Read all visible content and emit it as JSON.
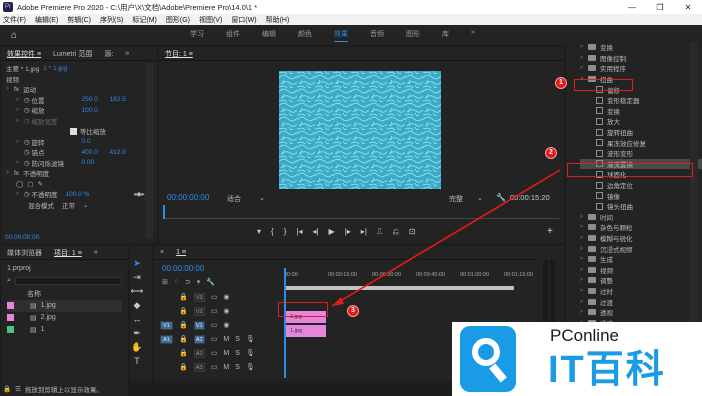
{
  "window": {
    "title": "Adobe Premiere Pro 2020 - C:\\用户\\X\\文档\\Adobe\\Premiere Pro\\14.0\\1 *",
    "controls": [
      "—",
      "❐",
      "✕"
    ]
  },
  "menu": [
    "文件(F)",
    "编辑(E)",
    "剪辑(C)",
    "序列(S)",
    "标记(M)",
    "图形(G)",
    "视图(V)",
    "窗口(W)",
    "帮助(H)"
  ],
  "workspaces": {
    "tabs": [
      "学习",
      "组件",
      "编辑",
      "颜色",
      "效果",
      "音频",
      "图形",
      "库"
    ],
    "active": "效果",
    "more": "»"
  },
  "effect_controls": {
    "tabs": [
      "效果控件 ≡",
      "Lumetri 范围",
      "源:"
    ],
    "more": "»",
    "clip": "主要 * 1.jpg",
    "clip_link": "1 * 1.jpg",
    "section_video": "视频",
    "motion": {
      "label": "运动",
      "position_label": "位置",
      "position_x": "250.0",
      "position_y": "182.5",
      "scale_label": "缩放",
      "scale_value": "100.0",
      "scale_width_label": "缩放宽度",
      "uniform_label": "等比缩放",
      "rotation_label": "旋转",
      "rotation_value": "0.0",
      "anchor_label": "锚点",
      "anchor_x": "400.0",
      "anchor_y": "412.0",
      "antiflicker_label": "防闪烁滤镜",
      "antiflicker_value": "0.00"
    },
    "opacity": {
      "label": "不透明度",
      "value_label": "不透明度",
      "value": "100.0 %",
      "blend_label": "混合模式",
      "blend_value": "正常"
    },
    "timecode": "00:00:00:00"
  },
  "program": {
    "title": "节目: 1 ≡",
    "timecode_left": "00:00:00:00",
    "fit": "适合",
    "quality": "完整",
    "timecode_right": "00:00:15:20",
    "transport": [
      "▾",
      "{",
      "}",
      "|◂",
      "◂|",
      "▶",
      "|▸",
      "▸|",
      "⎍",
      "⎌",
      "⊡"
    ],
    "add": "+"
  },
  "project": {
    "tabs": [
      "媒体浏览器",
      "项目: 1 ≡"
    ],
    "more": "»",
    "file": "1.prproj",
    "column_name": "名称",
    "items": [
      {
        "name": "1.jpg",
        "color": "#e586dc"
      },
      {
        "name": "2.jpg",
        "color": "#e586dc"
      },
      {
        "name": "1",
        "color": "#4ec280"
      }
    ],
    "status": "拖放到剪辑上以显示效果。"
  },
  "timeline": {
    "title": "1 ≡",
    "close": "×",
    "timecode": "00:00:00:00",
    "ruler": [
      "00:00",
      "00:00:15:00",
      "00:00:30:00",
      "00:00:45:00",
      "00:01:00:00",
      "00:01:15:00"
    ],
    "video_tracks": [
      "V3",
      "V2",
      "V1"
    ],
    "audio_tracks": [
      "A1",
      "A2",
      "A3"
    ],
    "v_source": "V1",
    "a_source": "A1",
    "clip_top": "2.jpg",
    "clip_bottom": "1.jpg"
  },
  "effects_panel": {
    "items": [
      {
        "label": "变换",
        "kind": "folder"
      },
      {
        "label": "图像控制",
        "kind": "folder"
      },
      {
        "label": "实用程序",
        "kind": "folder"
      },
      {
        "label": "扭曲",
        "kind": "folder-open"
      },
      {
        "label": "偏移",
        "kind": "fx"
      },
      {
        "label": "变形稳定器",
        "kind": "fx"
      },
      {
        "label": "变换",
        "kind": "fx"
      },
      {
        "label": "放大",
        "kind": "fx"
      },
      {
        "label": "旋转扭曲",
        "kind": "fx"
      },
      {
        "label": "果冻效应修复",
        "kind": "fx"
      },
      {
        "label": "波形变形",
        "kind": "fx"
      },
      {
        "label": "湍流置换",
        "kind": "fx-selected"
      },
      {
        "label": "球面化",
        "kind": "fx"
      },
      {
        "label": "边角定位",
        "kind": "fx"
      },
      {
        "label": "镜像",
        "kind": "fx"
      },
      {
        "label": "镜头扭曲",
        "kind": "fx"
      },
      {
        "label": "时间",
        "kind": "folder"
      },
      {
        "label": "杂色与颗粒",
        "kind": "folder"
      },
      {
        "label": "模糊与锐化",
        "kind": "folder"
      },
      {
        "label": "沉浸式视频",
        "kind": "folder"
      },
      {
        "label": "生成",
        "kind": "folder"
      },
      {
        "label": "视频",
        "kind": "folder"
      },
      {
        "label": "调整",
        "kind": "folder"
      },
      {
        "label": "过时",
        "kind": "folder"
      },
      {
        "label": "过渡",
        "kind": "folder"
      },
      {
        "label": "透视",
        "kind": "folder"
      },
      {
        "label": "通道",
        "kind": "folder"
      }
    ]
  },
  "annotations": [
    "1",
    "2",
    "3"
  ],
  "watermark": {
    "brand": "PConline",
    "name": "IT百科"
  },
  "colors": {
    "accent": "#2d8ceb",
    "annotation": "#e21b1b",
    "clip_pink": "#e586dc",
    "clip_green": "#4ec280"
  }
}
